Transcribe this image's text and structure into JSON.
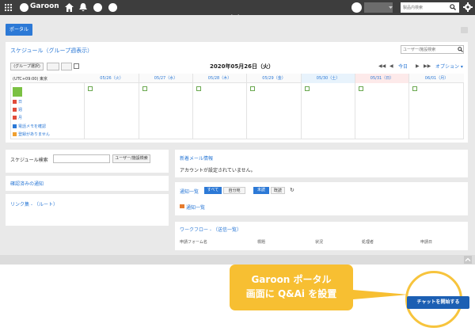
{
  "topbar": {
    "logo": "Garoon",
    "search_placeholder": "製品内検索"
  },
  "portal_tab": "ポータル",
  "schedule": {
    "title": "スケジュール（グループ週表示）",
    "search_placeholder": "ユーザー/施設検索",
    "group_select": "(グループ選択)",
    "date_title": "2020年05月26日（火）",
    "today": "今日",
    "options": "オプション ▾",
    "timezone": "(UTC+09:00) 東京",
    "days": [
      "05/26（火）",
      "05/27（水）",
      "05/28（木）",
      "05/29（金）",
      "05/30（土）",
      "05/31（日）",
      "06/01（月）"
    ],
    "links": [
      "日",
      "週",
      "月"
    ],
    "memo": "電話メモを確認",
    "no_memo": "登録がありません"
  },
  "left_panels": {
    "search_label": "スケジュール検索",
    "search_button": "ユーザー/施設検索",
    "confirmed": "確認済みの通知",
    "links": "リンク集 - （ルート）"
  },
  "mail": {
    "title": "新着メール情報",
    "message": "アカウントが設定されていません。"
  },
  "notify": {
    "title": "通知一覧",
    "tab_all": "すべて",
    "tab_mine": "自分宛",
    "tab_unread": "未読",
    "tab_read": "既読",
    "link": "通知一覧"
  },
  "workflow": {
    "title": "ワークフロー - （送信一覧）",
    "columns": [
      "申請フォーム名",
      "標題",
      "状況",
      "処理者",
      "申請日"
    ]
  },
  "callout": {
    "line1": "Garoon ポータル",
    "line2": "画面に Q&Ai を設置"
  },
  "chat_button": "チャットを開始する",
  "colors": {
    "accent": "#2c79d6",
    "topbar": "#3d3d3d",
    "callout": "#f7bf32",
    "chat_button": "#1c5fb3"
  }
}
